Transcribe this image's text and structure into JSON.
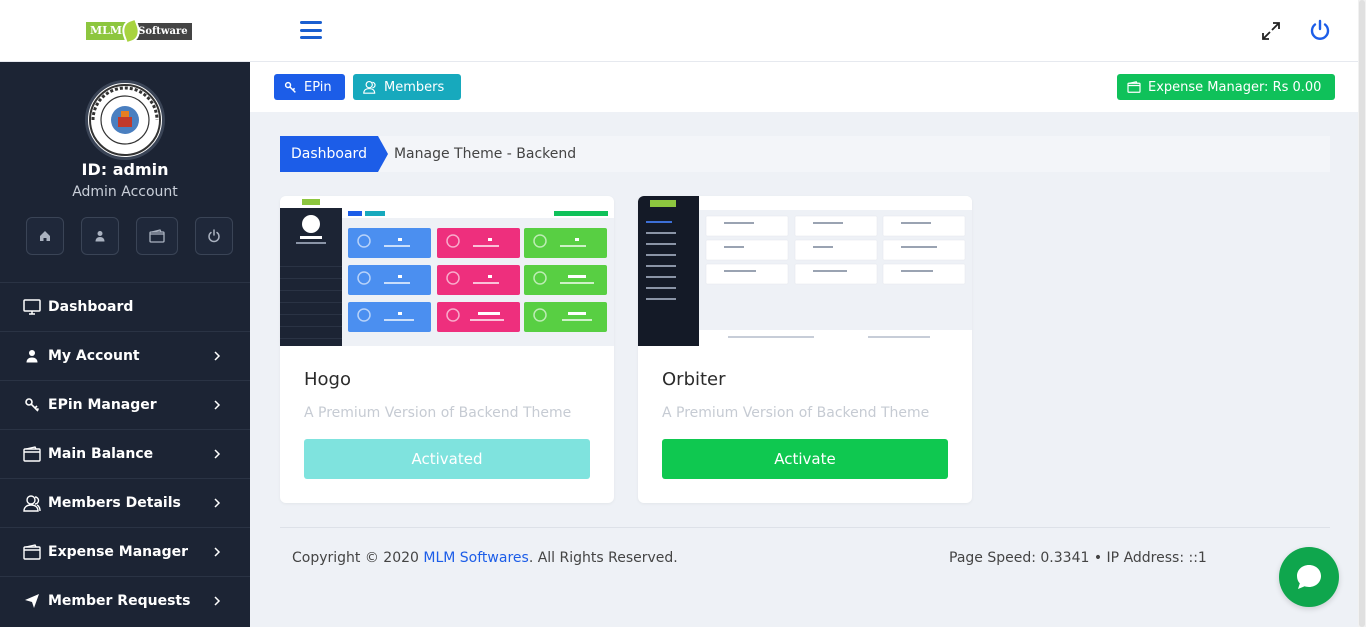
{
  "header": {
    "logo_left": "MLM",
    "logo_right": "Software",
    "icons": [
      "menu-icon",
      "expand-icon",
      "power-icon"
    ]
  },
  "sidebar": {
    "avatar_text": "DOMAINSROCK INDIA",
    "user_id": "ID: admin",
    "user_role": "Admin Account",
    "quick_icons": [
      "home-icon",
      "user-icon",
      "wallet-icon",
      "power-icon"
    ],
    "items": [
      {
        "label": "Dashboard",
        "icon": "monitor-icon",
        "chevron": false
      },
      {
        "label": "My Account",
        "icon": "user-icon",
        "chevron": true
      },
      {
        "label": "EPin Manager",
        "icon": "key-icon",
        "chevron": true
      },
      {
        "label": "Main Balance",
        "icon": "wallet-icon",
        "chevron": true
      },
      {
        "label": "Members Details",
        "icon": "users-icon",
        "chevron": true
      },
      {
        "label": "Expense Manager",
        "icon": "wallet-icon",
        "chevron": true
      },
      {
        "label": "Member Requests",
        "icon": "send-icon",
        "chevron": true
      }
    ]
  },
  "toolbar": {
    "epin_label": "EPin",
    "members_label": "Members",
    "expense_label": "Expense Manager: Rs 0.00"
  },
  "breadcrumb": {
    "active": "Dashboard",
    "current": "Manage Theme - Backend"
  },
  "themes": [
    {
      "name": "Hogo",
      "description": "A Premium Version of Backend Theme",
      "button": "Activated",
      "status": "active"
    },
    {
      "name": "Orbiter",
      "description": "A Premium Version of Backend Theme",
      "button": "Activate",
      "status": "inactive"
    }
  ],
  "footer": {
    "copyright_prefix": "Copyright © 2020 ",
    "copyright_link": "MLM Softwares",
    "copyright_suffix": ". All Rights Reserved.",
    "page_speed": "Page Speed: 0.3341 • IP Address: ::1"
  },
  "colors": {
    "sidebar_bg": "#1c2434",
    "primary": "#1c5de8",
    "info": "#17a9bd",
    "success": "#0fc15a",
    "activated": "#7fe3de"
  }
}
